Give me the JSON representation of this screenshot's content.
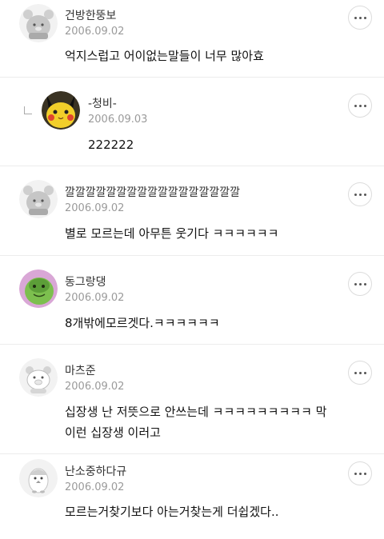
{
  "comments": [
    {
      "nickname": "건방한뚱보",
      "date": "2006.09.02",
      "text": "억지스럽고 어이없는말들이 너무 많아효",
      "avatar_icon": "gray-bear-icon"
    },
    {
      "nickname": "-청비-",
      "date": "2006.09.03",
      "text": "222222",
      "avatar_icon": "pikachu-icon",
      "is_reply": true
    },
    {
      "nickname": "깔깔깔깔깔깔깔깔깔깔깔깔깔깔깔깔깔",
      "date": "2006.09.02",
      "text": "별로 모르는데 아무튼 웃기다 ㅋㅋㅋㅋㅋㅋ",
      "avatar_icon": "gray-bear-icon"
    },
    {
      "nickname": "동그랑댕",
      "date": "2006.09.02",
      "text": "8개밖에모르겟다.ㅋㅋㅋㅋㅋㅋ",
      "avatar_icon": "green-character-icon"
    },
    {
      "nickname": "마츠준",
      "date": "2006.09.02",
      "text_lines": [
        "십장생 난 저뜻으로 안쓰는데 ㅋㅋㅋㅋㅋㅋㅋㅋㅋ 막",
        "이런 십장생 이러고"
      ],
      "avatar_icon": "white-pig-icon"
    },
    {
      "nickname": "난소중하다규",
      "date": "2006.09.02",
      "text": "모르는거찾기보다 아는거찾는게 더쉽겠다..",
      "avatar_icon": "penguin-icon"
    }
  ],
  "more_button_icon": "more-dots-icon"
}
